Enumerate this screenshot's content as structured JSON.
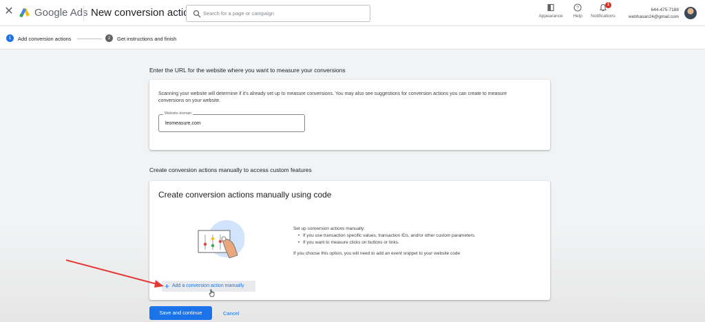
{
  "header": {
    "brand": "Google Ads",
    "page_title": "New conversion action",
    "search_placeholder": "Search for a page or campaign",
    "tools": [
      {
        "label": "Appearance",
        "icon": "appearance-icon"
      },
      {
        "label": "Help",
        "icon": "help-icon"
      },
      {
        "label": "Notifications",
        "icon": "bell-icon",
        "badge": "1"
      }
    ],
    "account": {
      "phone": "644-475-7188",
      "email": "webhasan24@gmail.com"
    }
  },
  "stepper": {
    "steps": [
      {
        "num": "1",
        "label": "Add conversion actions",
        "active": true
      },
      {
        "num": "2",
        "label": "Get instructions and finish",
        "active": false
      }
    ]
  },
  "url_section": {
    "heading": "Enter the URL for the website where you want to measure your conversions",
    "description": "Scanning your website will determine if it's already set up to measure conversions. You may also see suggestions for conversion actions you can create to measure conversions on your website.",
    "field_label": "Website domain",
    "field_value": "leomeasure.com"
  },
  "manual_section": {
    "heading": "Create conversion actions manually to access custom features",
    "card_title": "Create conversion actions manually using code",
    "intro": "Set up conversion actions manually:",
    "bullets": [
      "If you use transaction specific values, transaction IDs, and/or other custom parameters.",
      "If you want to measure clicks on buttons or links."
    ],
    "note": "If you choose this option, you will need to add an event snippet to your website code",
    "add_label": "Add a conversion action manually"
  },
  "footer": {
    "save_label": "Save and continue",
    "cancel_label": "Cancel"
  },
  "colors": {
    "accent": "#1a73e8",
    "inactive_step": "#5f6368",
    "annotation_arrow": "#e53935"
  }
}
